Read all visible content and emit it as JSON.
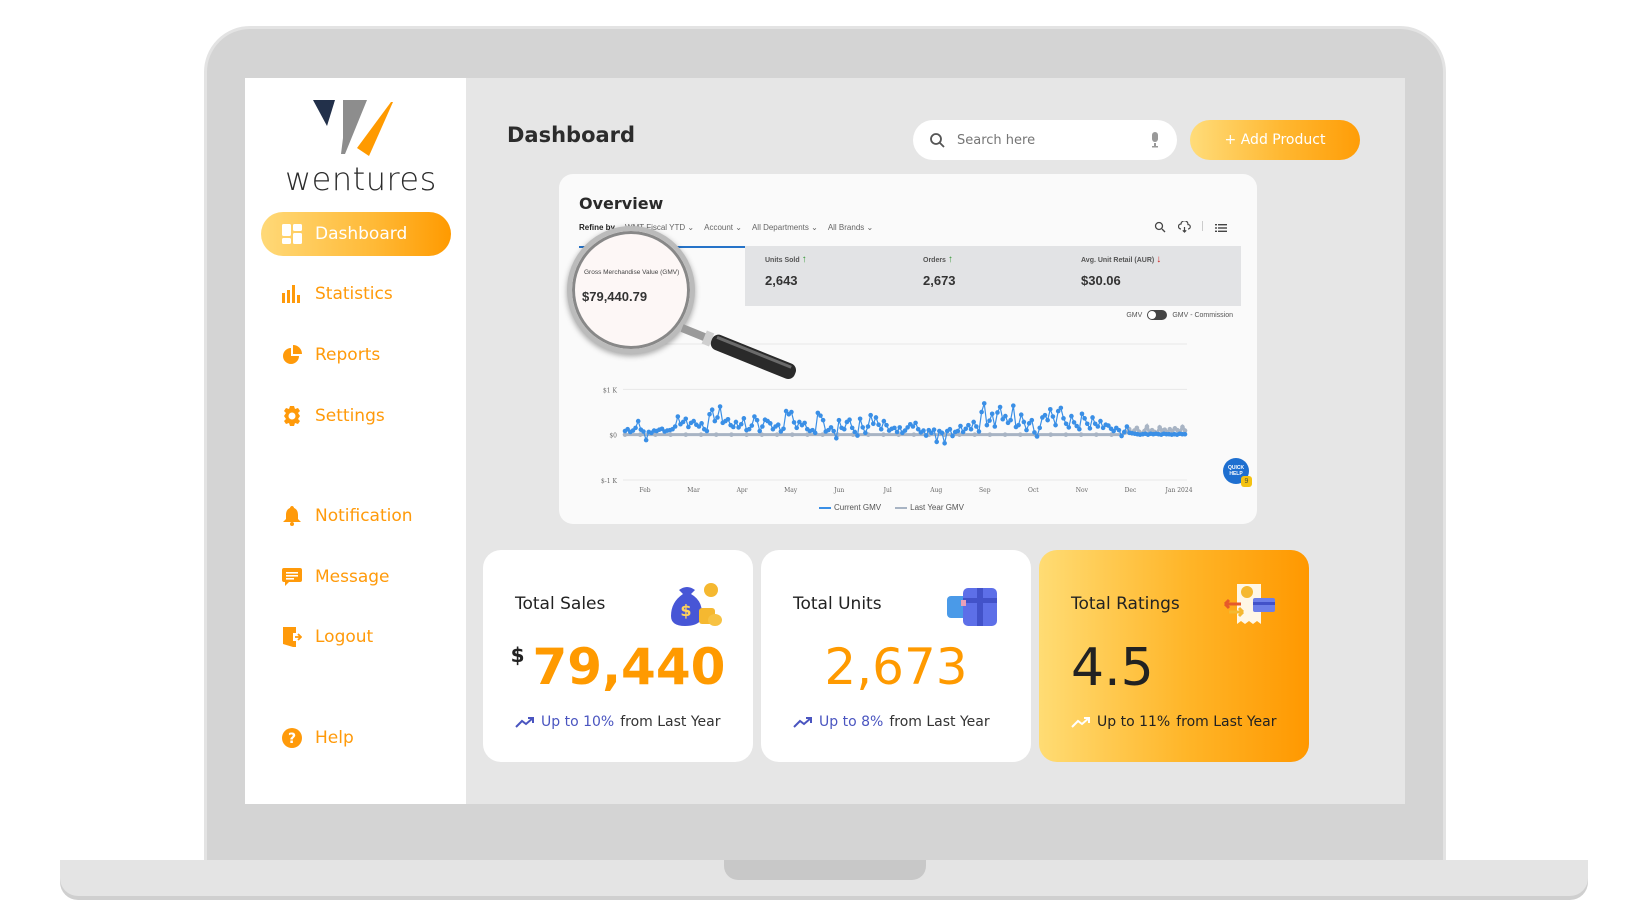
{
  "brand": {
    "name": "wentures",
    "accent": "#ff9a00"
  },
  "sidebar": {
    "items": [
      {
        "label": "Dashboard",
        "icon": "dashboard-grid-icon",
        "active": true
      },
      {
        "label": "Statistics",
        "icon": "bar-chart-icon"
      },
      {
        "label": "Reports",
        "icon": "pie-chart-icon"
      },
      {
        "label": "Settings",
        "icon": "gear-icon"
      },
      {
        "label": "Notification",
        "icon": "bell-icon"
      },
      {
        "label": "Message",
        "icon": "message-icon"
      },
      {
        "label": "Logout",
        "icon": "logout-door-icon"
      },
      {
        "label": "Help",
        "icon": "help-circle-icon"
      }
    ]
  },
  "header": {
    "title": "Dashboard",
    "search_placeholder": "Search here",
    "add_button": "+ Add Product"
  },
  "overview": {
    "title": "Overview",
    "refine_label": "Refine by",
    "filters": [
      "WMT Fiscal YTD",
      "Account",
      "All Departments",
      "All Brands"
    ],
    "metrics": [
      {
        "label": "Gross Merchandise Value (GMV)",
        "value": "$79,440.79",
        "trend": "up"
      },
      {
        "label": "Units Sold",
        "value": "2,643",
        "trend": "up"
      },
      {
        "label": "Orders",
        "value": "2,673",
        "trend": "up"
      },
      {
        "label": "Avg. Unit Retail (AUR)",
        "value": "$30.06",
        "trend": "down"
      }
    ],
    "toggle_left": "GMV",
    "toggle_right": "GMV - Commission",
    "quick_help": "QUICK HELP",
    "quick_help_count": "9",
    "peek_text": "year"
  },
  "chart_data": {
    "type": "line",
    "title": "",
    "xlabel": "",
    "ylabel": "",
    "x_ticks": [
      "Feb",
      "Mar",
      "Apr",
      "May",
      "Jun",
      "Jul",
      "Aug",
      "Sep",
      "Oct",
      "Nov",
      "Dec",
      "Jan 2024"
    ],
    "y_ticks": [
      "$-1 K",
      "$0",
      "$1 K",
      "$2 K"
    ],
    "ylim": [
      -1000,
      2000
    ],
    "grid": true,
    "legend": "bottom",
    "series": [
      {
        "name": "Current GMV",
        "color": "#3a8fe6",
        "values": [
          80,
          120,
          60,
          90,
          150,
          300,
          110,
          70,
          -120,
          60,
          40,
          90,
          80,
          110,
          130,
          70,
          90,
          100,
          120,
          180,
          400,
          230,
          280,
          350,
          170,
          260,
          300,
          220,
          180,
          250,
          120,
          80,
          450,
          550,
          300,
          380,
          620,
          260,
          300,
          340,
          210,
          170,
          280,
          160,
          230,
          360,
          100,
          120,
          200,
          400,
          320,
          80,
          180,
          330,
          300,
          250,
          120,
          180,
          220,
          70,
          130,
          520,
          450,
          500,
          270,
          150,
          280,
          210,
          260,
          120,
          80,
          100,
          40,
          480,
          420,
          320,
          70,
          100,
          160,
          80,
          -80,
          320,
          150,
          120,
          280,
          330,
          150,
          60,
          -20,
          350,
          160,
          40,
          180,
          430,
          240,
          380,
          220,
          120,
          300,
          210,
          90,
          130,
          150,
          60,
          160,
          40,
          90,
          160,
          230,
          180,
          260,
          120,
          50,
          90,
          -20,
          100,
          40,
          110,
          -160,
          80,
          40,
          -190,
          80,
          120,
          -30,
          60,
          80,
          190,
          60,
          130,
          210,
          120,
          280,
          180,
          70,
          500,
          690,
          210,
          310,
          460,
          180,
          490,
          610,
          340,
          410,
          260,
          320,
          640,
          170,
          210,
          440,
          280,
          100,
          250,
          320,
          50,
          -40,
          150,
          380,
          430,
          320,
          560,
          400,
          210,
          520,
          590,
          360,
          240,
          160,
          410,
          270,
          190,
          120,
          460,
          360,
          240,
          140,
          380,
          240,
          180,
          300,
          150,
          220,
          200,
          130,
          80,
          150,
          100,
          -30,
          60,
          180,
          40,
          30,
          20,
          10,
          0,
          10,
          20,
          0,
          20,
          10,
          20,
          10,
          0,
          20,
          10,
          10,
          0,
          10,
          0,
          20,
          10,
          10
        ]
      },
      {
        "name": "Last Year GMV",
        "color": "#a8b4c4",
        "values": [
          0,
          0,
          0,
          0,
          0,
          0,
          0,
          0,
          0,
          0,
          0,
          0,
          0,
          0,
          0,
          0,
          0,
          0,
          0,
          0,
          0,
          0,
          0,
          0,
          0,
          0,
          0,
          0,
          0,
          0,
          0,
          0,
          0,
          0,
          0,
          0,
          0,
          0,
          0,
          0,
          0,
          0,
          0,
          0,
          0,
          0,
          0,
          0,
          0,
          0,
          0,
          0,
          0,
          0,
          0,
          0,
          0,
          0,
          0,
          0,
          0,
          0,
          0,
          0,
          0,
          0,
          0,
          0,
          0,
          0,
          0,
          0,
          0,
          0,
          0,
          0,
          0,
          0,
          0,
          0,
          0,
          0,
          0,
          0,
          0,
          0,
          0,
          0,
          0,
          0,
          0,
          0,
          0,
          0,
          0,
          0,
          0,
          0,
          0,
          0,
          0,
          0,
          0,
          0,
          0,
          0,
          0,
          0,
          0,
          0,
          0,
          0,
          0,
          0,
          0,
          0,
          0,
          0,
          0,
          0,
          0,
          0,
          0,
          0,
          0,
          0,
          0,
          0,
          0,
          0,
          0,
          0,
          0,
          0,
          0,
          0,
          0,
          0,
          0,
          0,
          0,
          0,
          0,
          0,
          0,
          0,
          0,
          0,
          0,
          0,
          0,
          0,
          0,
          0,
          0,
          0,
          0,
          0,
          0,
          0,
          0,
          0,
          0,
          0,
          0,
          0,
          0,
          0,
          0,
          0,
          0,
          0,
          0,
          0,
          0,
          0,
          0,
          0,
          0,
          0,
          0,
          0,
          0,
          0,
          0,
          0,
          0,
          0,
          0,
          0,
          0,
          0,
          0,
          0,
          0,
          0,
          0,
          40,
          60,
          120,
          30,
          90,
          150,
          60,
          20,
          80,
          180,
          40,
          100,
          60,
          30,
          160,
          90,
          110,
          50,
          120,
          80,
          140,
          100,
          60,
          170,
          90
        ]
      }
    ]
  },
  "cards": [
    {
      "title": "Total Sales",
      "currency": "$",
      "value": "79,440",
      "trend_highlight": "Up to 10%",
      "trend_rest": "from Last Year",
      "illustration": "money-bag-icon"
    },
    {
      "title": "Total Units",
      "value": "2,673",
      "trend_highlight": "Up to 8%",
      "trend_rest": "from Last Year",
      "illustration": "gift-boxes-icon"
    },
    {
      "title": "Total Ratings",
      "value": "4.5",
      "trend_highlight": "Up to 11%",
      "trend_rest": "from Last Year",
      "illustration": "payment-receipt-icon"
    }
  ]
}
